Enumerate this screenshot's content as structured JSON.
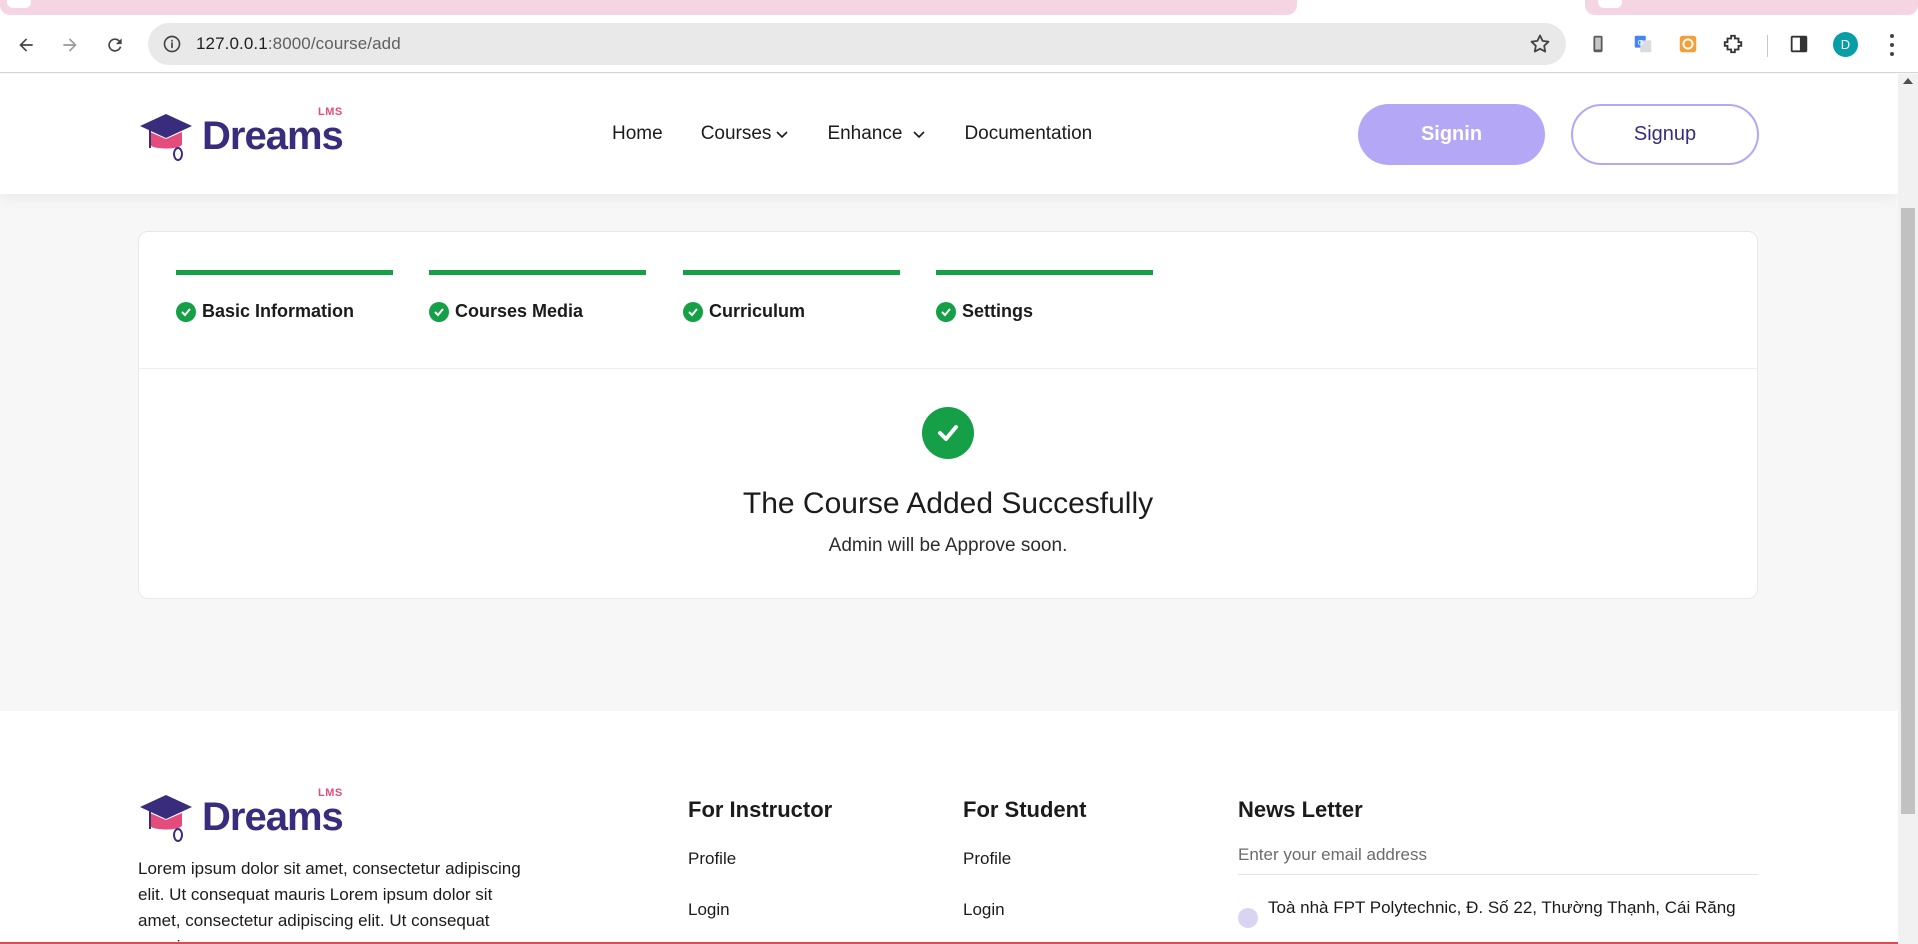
{
  "browser": {
    "url_host": "127.0.0.1",
    "url_path": ":8000/course/add",
    "profile_initial": "D"
  },
  "header": {
    "logo_word": "Dreams",
    "logo_badge": "LMS",
    "nav": [
      {
        "label": "Home",
        "has_dropdown": false
      },
      {
        "label": "Courses",
        "has_dropdown": true
      },
      {
        "label": "Enhance",
        "has_dropdown": true
      },
      {
        "label": "Documentation",
        "has_dropdown": false
      }
    ],
    "signin_label": "Signin",
    "signup_label": "Signup"
  },
  "steps": [
    {
      "label": "Basic Information",
      "completed": true
    },
    {
      "label": "Courses Media",
      "completed": true
    },
    {
      "label": "Curriculum",
      "completed": true
    },
    {
      "label": "Settings",
      "completed": true
    }
  ],
  "success": {
    "title": "The Course Added Succesfully",
    "message": "Admin will be Approve soon."
  },
  "footer": {
    "logo_word": "Dreams",
    "logo_badge": "LMS",
    "about": "Lorem ipsum dolor sit amet, consectetur adipiscing elit. Ut consequat mauris Lorem ipsum dolor sit amet, consectetur adipiscing elit. Ut consequat mauris",
    "instructor": {
      "title": "For Instructor",
      "links": [
        "Profile",
        "Login"
      ]
    },
    "student": {
      "title": "For Student",
      "links": [
        "Profile",
        "Login"
      ]
    },
    "newsletter": {
      "title": "News Letter",
      "placeholder": "Enter your email address",
      "address": "Toà nhà FPT Polytechnic, Đ. Số 22, Thường Thạnh, Cái Răng"
    }
  },
  "colors": {
    "brand_purple": "#392c7d",
    "accent_pink": "#e44c7c",
    "signin_bg": "#b4a7f5",
    "success_green": "#159f46"
  }
}
